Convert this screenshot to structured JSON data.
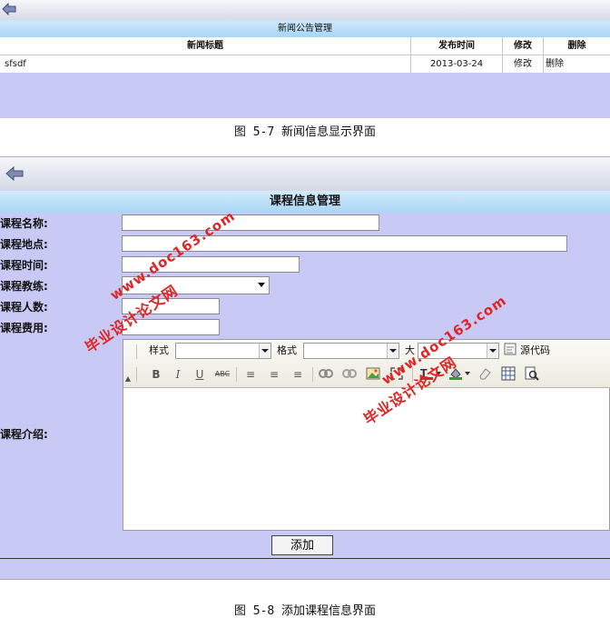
{
  "news_screen": {
    "title": "新闻公告管理",
    "columns": [
      "新闻标题",
      "发布时间",
      "修改",
      "删除"
    ],
    "rows": [
      {
        "title": "sfsdf",
        "date": "2013-03-24",
        "edit": "修改",
        "delete": "删除"
      }
    ]
  },
  "caption1": "图 5-7 新闻信息显示界面",
  "course_screen": {
    "title": "课程信息管理",
    "fields": {
      "name_label": "课程名称:",
      "location_label": "课程地点:",
      "time_label": "课程时间:",
      "coach_label": "课程教练:",
      "capacity_label": "课程人数:",
      "fee_label": "课程费用:",
      "intro_label": "课程介绍:"
    },
    "editor": {
      "style_label": "样式",
      "format_label": "格式",
      "size_label": "大",
      "source_label": "源代码"
    },
    "add_button": "添加"
  },
  "caption2": "图 5-8 添加课程信息界面",
  "watermarks": {
    "url": "www.doc163.com",
    "cn": "毕业设计论文网"
  }
}
